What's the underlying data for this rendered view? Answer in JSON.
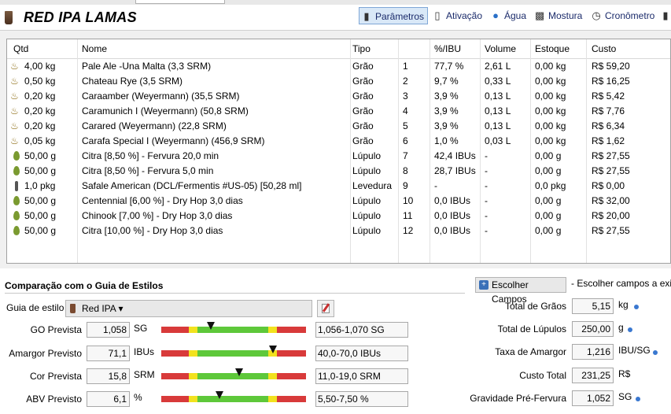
{
  "recipe": {
    "title": "RED IPA LAMAS"
  },
  "toolbar": [
    {
      "label": "Parâmetros",
      "icon": "beer-glass-icon",
      "active": true
    },
    {
      "label": "Ativação",
      "icon": "tube-icon",
      "active": false
    },
    {
      "label": "Água",
      "icon": "water-drop-icon",
      "active": false
    },
    {
      "label": "Mostura",
      "icon": "mash-tun-icon",
      "active": false
    },
    {
      "label": "Cronômetro",
      "icon": "stopwatch-icon",
      "active": false
    }
  ],
  "ingredients": {
    "headers": [
      "Qtd",
      "Nome",
      "Tipo",
      "",
      "%/IBU",
      "Volume",
      "Estoque",
      "Custo"
    ],
    "rows": [
      {
        "icon": "grain",
        "qtd": "4,00 kg",
        "nome": " Pale Ale -Una Malta (3,3 SRM)",
        "tipo": "Grão",
        "n": "1",
        "pct": "77,7 %",
        "vol": "2,61 L",
        "est": "0,00 kg",
        "custo": "R$ 59,20"
      },
      {
        "icon": "grain",
        "qtd": "0,50 kg",
        "nome": "Chateau Rye (3,5 SRM)",
        "tipo": "Grão",
        "n": "2",
        "pct": "9,7 %",
        "vol": "0,33 L",
        "est": "0,00 kg",
        "custo": "R$ 16,25"
      },
      {
        "icon": "grain",
        "qtd": "0,20 kg",
        "nome": "Caraamber (Weyermann) (35,5 SRM)",
        "tipo": "Grão",
        "n": "3",
        "pct": "3,9 %",
        "vol": "0,13 L",
        "est": "0,00 kg",
        "custo": "R$ 5,42"
      },
      {
        "icon": "grain",
        "qtd": "0,20 kg",
        "nome": "Caramunich I (Weyermann) (50,8 SRM)",
        "tipo": "Grão",
        "n": "4",
        "pct": "3,9 %",
        "vol": "0,13 L",
        "est": "0,00 kg",
        "custo": "R$ 7,76"
      },
      {
        "icon": "grain",
        "qtd": "0,20 kg",
        "nome": "Carared (Weyermann) (22,8 SRM)",
        "tipo": "Grão",
        "n": "5",
        "pct": "3,9 %",
        "vol": "0,13 L",
        "est": "0,00 kg",
        "custo": "R$ 6,34"
      },
      {
        "icon": "grain",
        "qtd": "0,05 kg",
        "nome": "Carafa Special I (Weyermann) (456,9 SRM)",
        "tipo": "Grão",
        "n": "6",
        "pct": "1,0 %",
        "vol": "0,03 L",
        "est": "0,00 kg",
        "custo": "R$ 1,62"
      },
      {
        "icon": "hop",
        "qtd": "50,00 g",
        "nome": "Citra [8,50 %] - Fervura 20,0 min",
        "tipo": "Lúpulo",
        "n": "7",
        "pct": "42,4 IBUs",
        "vol": "-",
        "est": "0,00 g",
        "custo": "R$ 27,55"
      },
      {
        "icon": "hop",
        "qtd": "50,00 g",
        "nome": "Citra [8,50 %] - Fervura 5,0 min",
        "tipo": "Lúpulo",
        "n": "8",
        "pct": "28,7 IBUs",
        "vol": "-",
        "est": "0,00 g",
        "custo": "R$ 27,55"
      },
      {
        "icon": "yeast",
        "qtd": "1,0 pkg",
        "nome": "Safale American  (DCL/Fermentis #US-05) [50,28 ml]",
        "tipo": "Levedura",
        "n": "9",
        "pct": "-",
        "vol": "-",
        "est": "0,0 pkg",
        "custo": "R$ 0,00"
      },
      {
        "icon": "hop",
        "qtd": "50,00 g",
        "nome": "Centennial [6,00 %] - Dry Hop 3,0 dias",
        "tipo": "Lúpulo",
        "n": "10",
        "pct": "0,0 IBUs",
        "vol": "-",
        "est": "0,00 g",
        "custo": "R$ 32,00"
      },
      {
        "icon": "hop",
        "qtd": "50,00 g",
        "nome": "Chinook [7,00 %] - Dry Hop 3,0 dias",
        "tipo": "Lúpulo",
        "n": "11",
        "pct": "0,0 IBUs",
        "vol": "-",
        "est": "0,00 g",
        "custo": "R$ 20,00"
      },
      {
        "icon": "hop",
        "qtd": "50,00 g",
        "nome": "Citra [10,00 %] - Dry Hop 3,0 dias",
        "tipo": "Lúpulo",
        "n": "12",
        "pct": "0,0 IBUs",
        "vol": "-",
        "est": "0,00 g",
        "custo": "R$ 27,55"
      }
    ]
  },
  "style": {
    "section_title": "Comparação com o Guia de Estilos",
    "guide_label": "Guia de estilo",
    "guide_value": "Red IPA",
    "metrics": [
      {
        "label": "GO Prevista",
        "value": "1,058",
        "unit": "SG",
        "range": "1,056-1,070 SG",
        "position_pct": 34
      },
      {
        "label": "Amargor Previsto",
        "value": "71,1",
        "unit": "IBUs",
        "range": "40,0-70,0 IBUs",
        "position_pct": 77
      },
      {
        "label": "Cor Prevista",
        "value": "15,8",
        "unit": "SRM",
        "range": "11,0-19,0 SRM",
        "position_pct": 54
      },
      {
        "label": "ABV Previsto",
        "value": "6,1",
        "unit": "%",
        "range": "5,50-7,50 %",
        "position_pct": 40
      }
    ]
  },
  "choose_fields": {
    "label": "Escolher Campos",
    "hint": "- Escolher campos a exib"
  },
  "totals": [
    {
      "label": "Total de Grãos",
      "value": "5,15",
      "unit": "kg",
      "dot": true
    },
    {
      "label": "Total de Lúpulos",
      "value": "250,00",
      "unit": "g",
      "dot": true
    },
    {
      "label": "Taxa de Amargor",
      "value": "1,216",
      "unit": "IBU/SG",
      "dot": true
    },
    {
      "label": "Custo Total",
      "value": "231,25",
      "unit": "R$",
      "dot": false
    },
    {
      "label": "Gravidade Pré-Fervura",
      "value": "1,052",
      "unit": "SG",
      "dot": true
    }
  ]
}
